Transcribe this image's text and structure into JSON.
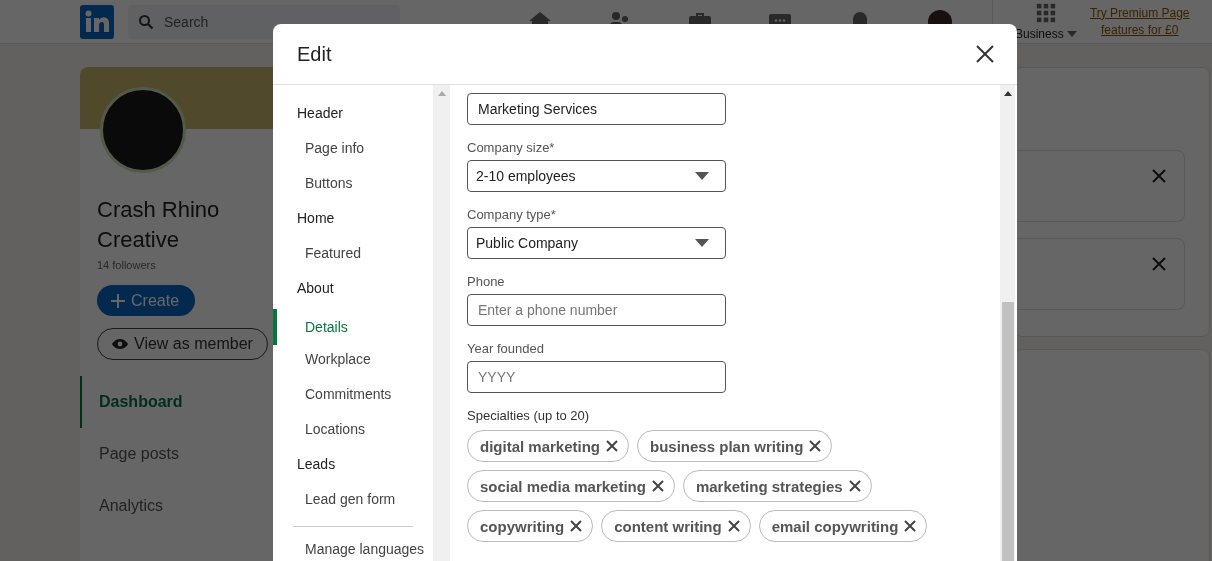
{
  "topnav": {
    "search": {
      "placeholder": "Search"
    },
    "business": "Business",
    "premium_link": "Try Premium Page features for £0"
  },
  "company": {
    "name": "Crash Rhino Creative",
    "followers": "14 followers",
    "create_button": "Create",
    "view_button": "View as member"
  },
  "page_nav": [
    {
      "label": "Dashboard",
      "selected": true
    },
    {
      "label": "Page posts",
      "selected": false
    },
    {
      "label": "Analytics",
      "selected": false
    }
  ],
  "modal": {
    "title": "Edit",
    "nav": [
      {
        "label": "Header",
        "kind": "heading",
        "selected": false
      },
      {
        "label": "Page info",
        "kind": "item",
        "selected": false
      },
      {
        "label": "Buttons",
        "kind": "item",
        "selected": false
      },
      {
        "label": "Home",
        "kind": "heading",
        "selected": false
      },
      {
        "label": "Featured",
        "kind": "item",
        "selected": false
      },
      {
        "label": "About",
        "kind": "heading",
        "selected": false
      },
      {
        "label": "Details",
        "kind": "item",
        "selected": true
      },
      {
        "label": "Workplace",
        "kind": "item",
        "selected": false
      },
      {
        "label": "Commitments",
        "kind": "item",
        "selected": false
      },
      {
        "label": "Locations",
        "kind": "item",
        "selected": false
      },
      {
        "label": "Leads",
        "kind": "heading",
        "selected": false
      },
      {
        "label": "Lead gen form",
        "kind": "item",
        "selected": false
      }
    ],
    "footer_link": "Manage languages",
    "fields": [
      {
        "kind": "text",
        "value": "Marketing Services"
      },
      {
        "kind": "select",
        "label": "Company size*",
        "value": "2-10 employees"
      },
      {
        "kind": "select",
        "label": "Company type*",
        "value": "Public Company"
      },
      {
        "kind": "text",
        "label": "Phone",
        "placeholder": "Enter a phone number"
      },
      {
        "kind": "text",
        "label": "Year founded",
        "placeholder": "YYYY"
      }
    ],
    "specialties_label": "Specialties (up to 20)",
    "specialties": [
      "digital marketing",
      "business plan writing",
      "social media marketing",
      "marketing strategies",
      "copywriting",
      "content writing",
      "email copywriting"
    ]
  }
}
